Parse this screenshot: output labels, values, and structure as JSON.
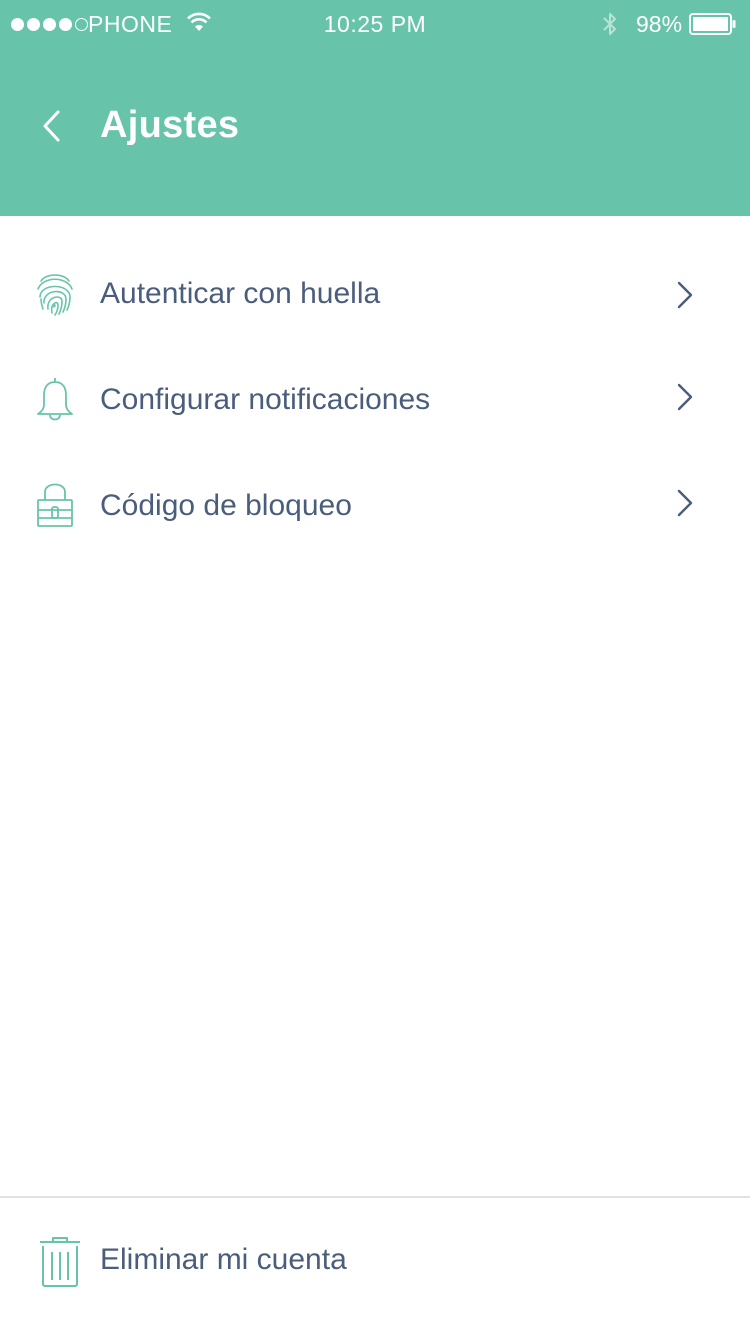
{
  "status_bar": {
    "carrier": "PHONE",
    "time": "10:25 PM",
    "battery": "98%"
  },
  "header": {
    "title": "Ajustes"
  },
  "menu": {
    "items": [
      {
        "label": "Autenticar con huella",
        "icon": "fingerprint-icon"
      },
      {
        "label": "Configurar notificaciones",
        "icon": "bell-icon"
      },
      {
        "label": "Código de bloqueo",
        "icon": "lock-icon"
      }
    ]
  },
  "footer": {
    "delete_label": "Eliminar mi cuenta",
    "icon": "trash-icon"
  },
  "colors": {
    "accent": "#67c4aa",
    "text": "#4b5d7c",
    "divider": "#e2e2e2"
  }
}
